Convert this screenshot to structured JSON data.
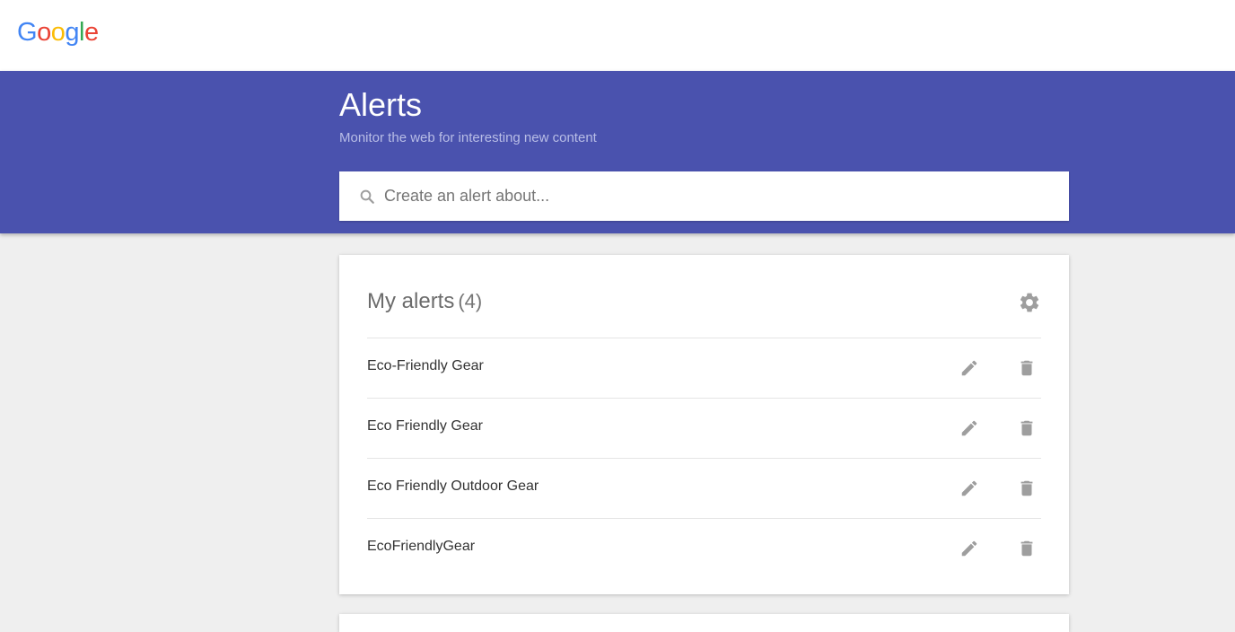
{
  "brand": {
    "logo_letters": [
      "G",
      "o",
      "o",
      "g",
      "l",
      "e"
    ],
    "logo_colors": [
      "#4285f4",
      "#ea4335",
      "#fbbc05",
      "#4285f4",
      "#34a853",
      "#ea4335"
    ]
  },
  "hero": {
    "title": "Alerts",
    "subtitle": "Monitor the web for interesting new content",
    "background": "#4a52ae"
  },
  "search": {
    "placeholder": "Create an alert about...",
    "value": "",
    "icon": "search-icon"
  },
  "my_alerts": {
    "title": "My alerts",
    "count": "(4)",
    "settings_icon": "gear-icon",
    "items": [
      {
        "name": "Eco-Friendly Gear",
        "edit_icon": "pencil-icon",
        "delete_icon": "trash-icon"
      },
      {
        "name": "Eco Friendly Gear",
        "edit_icon": "pencil-icon",
        "delete_icon": "trash-icon"
      },
      {
        "name": "Eco Friendly Outdoor Gear",
        "edit_icon": "pencil-icon",
        "delete_icon": "trash-icon"
      },
      {
        "name": "EcoFriendlyGear",
        "edit_icon": "pencil-icon",
        "delete_icon": "trash-icon"
      }
    ]
  }
}
